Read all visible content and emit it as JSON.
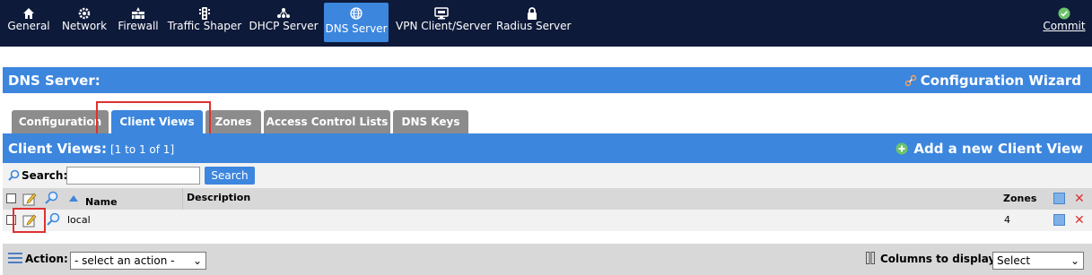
{
  "nav": {
    "items": [
      {
        "label": "General",
        "icon": "home-icon"
      },
      {
        "label": "Network",
        "icon": "gear-icon"
      },
      {
        "label": "Firewall",
        "icon": "firewall-icon"
      },
      {
        "label": "Traffic Shaper",
        "icon": "traffic-light-icon"
      },
      {
        "label": "DHCP Server",
        "icon": "network-nodes-icon"
      },
      {
        "label": "DNS Server",
        "icon": "globe-icon"
      },
      {
        "label": "VPN Client/Server",
        "icon": "monitor-icon"
      },
      {
        "label": "Radius Server",
        "icon": "lock-icon"
      }
    ],
    "active": "DNS Server",
    "commit": "Commit"
  },
  "header": {
    "title": "DNS Server:",
    "wizard": "Configuration Wizard"
  },
  "tabs": [
    {
      "label": "Configuration"
    },
    {
      "label": "Client Views"
    },
    {
      "label": "Zones"
    },
    {
      "label": "Access Control Lists"
    },
    {
      "label": "DNS Keys"
    }
  ],
  "active_tab": "Client Views",
  "list": {
    "title": "Client Views:",
    "count": "[1 to 1 of 1]",
    "add": "Add a new Client View"
  },
  "search": {
    "label": "Search:",
    "value": "",
    "button": "Search"
  },
  "table": {
    "columns": {
      "name": "Name",
      "description": "Description",
      "zones": "Zones"
    },
    "rows": [
      {
        "name": "local",
        "description": "",
        "zones": "4"
      }
    ]
  },
  "footer": {
    "action_label": "Action:",
    "action_value": "- select an action -",
    "columns_label": "Columns to display:",
    "columns_value": "Select"
  },
  "colors": {
    "nav_bg": "#0e1a3a",
    "accent": "#3c86de",
    "highlight": "#e03030",
    "delete": "#e03030"
  }
}
